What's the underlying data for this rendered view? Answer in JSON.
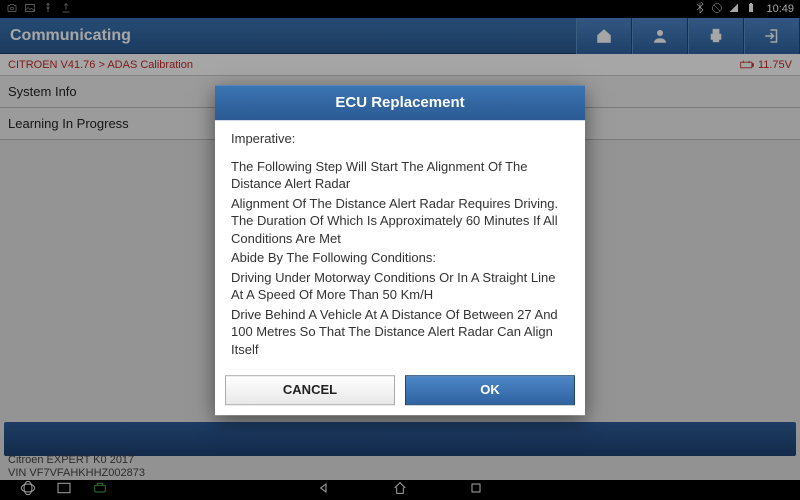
{
  "statusbar": {
    "clock": "10:49",
    "icons_left": [
      "camera",
      "image",
      "usb",
      "upload"
    ],
    "icons_right": [
      "bluetooth",
      "nowifi",
      "signal",
      "battery"
    ]
  },
  "header": {
    "title": "Communicating",
    "buttons": [
      "home",
      "support",
      "print",
      "exit"
    ]
  },
  "breadcrumb": {
    "path": "CITROEN V41.76 > ADAS Calibration",
    "voltage": "11.75V"
  },
  "rows": {
    "r1": "System Info",
    "r2": "Learning In Progress"
  },
  "vehicle": {
    "line1": "Citroen EXPERT K0 2017",
    "line2": "VIN VF7VFAHKHHZ002873"
  },
  "modal": {
    "title": "ECU Replacement",
    "imperative": "Imperative:",
    "p1": "The Following Step Will Start The Alignment Of The Distance Alert Radar",
    "p2": "Alignment Of The Distance Alert Radar Requires Driving. The Duration Of Which Is Approximately 60 Minutes If All Conditions Are Met",
    "p3": "Abide By The Following Conditions:",
    "p4": "Driving Under Motorway Conditions Or In A Straight Line At A Speed Of More Than 50 Km/H",
    "p5": "Drive Behind A Vehicle At A Distance Of Between 27 And 100 Metres So That The Distance Alert Radar Can Align Itself",
    "cancel": "CANCEL",
    "ok": "OK"
  }
}
